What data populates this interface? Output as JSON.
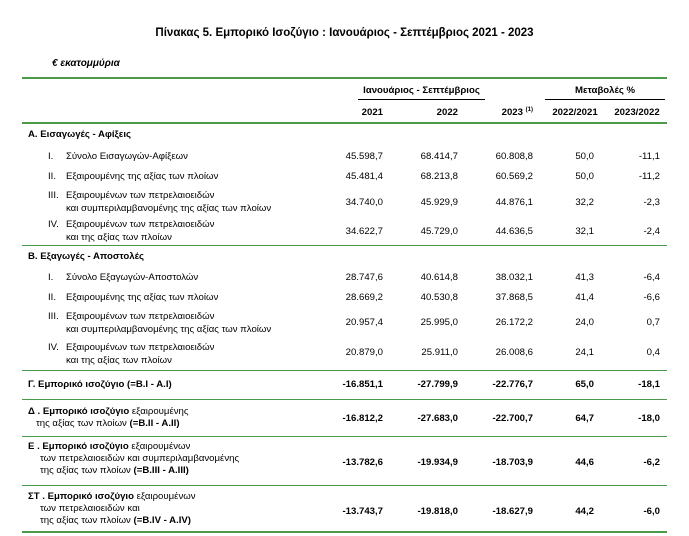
{
  "title": "Πίνακας 5. Εμπορικό Ισοζύγιο : Ιανουάριος - Σεπτέμβριος 2021 - 2023",
  "unit": "€ εκατομμύρια",
  "header": {
    "period_group": "Ιανουάριος - Σεπτέμβριος",
    "change_group": "Μεταβολές %",
    "col_2021": "2021",
    "col_2022": "2022",
    "col_2023": "2023",
    "col_2023_note": "(1)",
    "col_ch1": "2022/2021",
    "col_ch2": "2023/2022"
  },
  "sectionA": {
    "title": "Α. Εισαγωγές - Αφίξεις",
    "rows": [
      {
        "num": "I.",
        "lines": [
          "Σύνολο Εισαγωγών-Αφίξεων"
        ],
        "v2021": "45.598,7",
        "v2022": "68.414,7",
        "v2023": "60.808,8",
        "c1": "50,0",
        "c2": "-11,1"
      },
      {
        "num": "II.",
        "lines": [
          "Εξαιρουμένης  της αξίας των πλοίων"
        ],
        "v2021": "45.481,4",
        "v2022": "68.213,8",
        "v2023": "60.569,2",
        "c1": "50,0",
        "c2": "-11,2"
      },
      {
        "num": "III.",
        "lines": [
          "Εξαιρουμένων των πετρελαιοειδών",
          "και συμπεριλαμβανομένης της αξίας των πλοίων"
        ],
        "v2021": "34.740,0",
        "v2022": "45.929,9",
        "v2023": "44.876,1",
        "c1": "32,2",
        "c2": "-2,3"
      },
      {
        "num": "IV.",
        "lines": [
          "Εξαιρουμένων των πετρελαιοειδών",
          "και  της αξίας των πλοίων"
        ],
        "v2021": "34.622,7",
        "v2022": "45.729,0",
        "v2023": "44.636,5",
        "c1": "32,1",
        "c2": "-2,4"
      }
    ]
  },
  "sectionB": {
    "title": "Β. Εξαγωγές - Αποστολές",
    "rows": [
      {
        "num": "I.",
        "lines": [
          "Σύνολο Εξαγωγών-Αποστολών"
        ],
        "v2021": "28.747,6",
        "v2022": "40.614,8",
        "v2023": "38.032,1",
        "c1": "41,3",
        "c2": "-6,4"
      },
      {
        "num": "II.",
        "lines": [
          "Εξαιρουμένης  της αξίας των πλοίων"
        ],
        "v2021": "28.669,2",
        "v2022": "40.530,8",
        "v2023": "37.868,5",
        "c1": "41,4",
        "c2": "-6,6"
      },
      {
        "num": "III.",
        "lines": [
          "Εξαιρουμένων των πετρελαιοειδών",
          "και συμπεριλαμβανομένης  της αξίας των πλοίων"
        ],
        "v2021": "20.957,4",
        "v2022": "25.995,0",
        "v2023": "26.172,2",
        "c1": "24,0",
        "c2": "0,7"
      },
      {
        "num": "IV.",
        "lines": [
          "Εξαιρουμένων των πετρελαιοειδών",
          "και  της αξίας των πλοίων"
        ],
        "v2021": "20.879,0",
        "v2022": "25.911,0",
        "v2023": "26.008,6",
        "c1": "24,1",
        "c2": "0,4"
      }
    ]
  },
  "balances": [
    {
      "label_bold": "Γ. Εμπορικό ισοζύγιο (=B.I - A.I)",
      "v2021": "-16.851,1",
      "v2022": "-27.799,9",
      "v2023": "-22.776,7",
      "c1": "65,0",
      "c2": "-18,1"
    },
    {
      "label_bold": "Δ . Εμπορικό ισοζύγιο",
      "label_rest": " εξαιρουμένης",
      "line2_normal": "της αξίας των πλοίων",
      "line2_bold": " (=B.II - A.II)",
      "v2021": "-16.812,2",
      "v2022": "-27.683,0",
      "v2023": "-22.700,7",
      "c1": "64,7",
      "c2": "-18,0"
    },
    {
      "label_bold": "Ε . Εμπορικό ισοζύγιο",
      "label_rest": " εξαιρουμένων",
      "line2_normal": "των πετρελαιοειδών και συμπεριλαμβανομένης",
      "line3_normal": "της αξίας των πλοίων",
      "line3_bold": " (=B.III - A.III)",
      "v2021": "-13.782,6",
      "v2022": "-19.934,9",
      "v2023": "-18.703,9",
      "c1": "44,6",
      "c2": "-6,2"
    },
    {
      "label_bold": "ΣΤ . Εμπορικό ισοζύγιο",
      "label_rest": " εξαιρουμένων",
      "line2_normal": "των πετρελαιοειδών και",
      "line3_normal": "της αξίας των πλοίων",
      "line3_bold": " (=B.IV - A.IV)",
      "v2021": "-13.743,7",
      "v2022": "-19.818,0",
      "v2023": "-18.627,9",
      "c1": "44,2",
      "c2": "-6,0"
    }
  ]
}
